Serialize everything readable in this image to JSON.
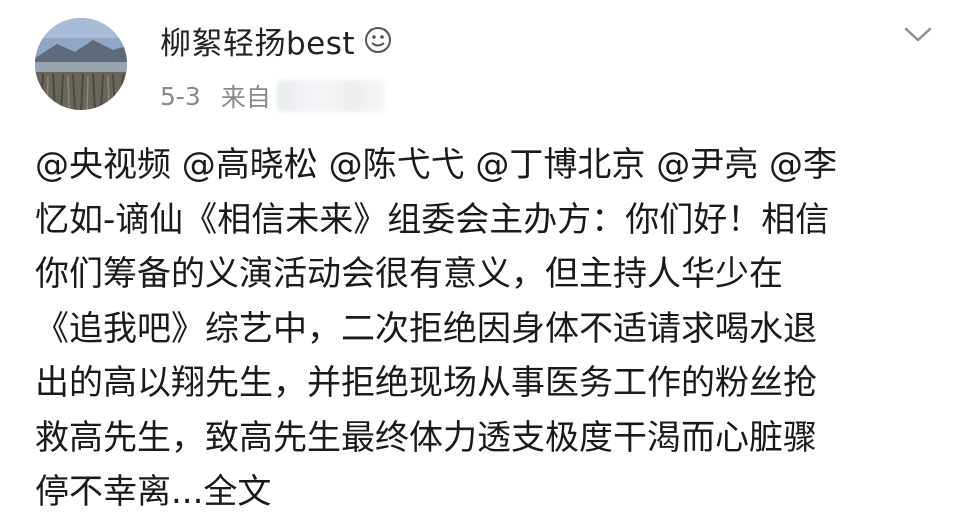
{
  "post": {
    "author": "柳絮轻扬best",
    "date": "5-3",
    "source_prefix": "来自",
    "body_lines": [
      "@央视频 @高晓松 @陈弋弋 @丁博北京 @尹亮 @李",
      "忆如-谪仙《相信未来》组委会主办方：你们好！相信",
      "你们筹备的义演活动会很有意义，但主持人华少在",
      "《追我吧》综艺中，二次拒绝因身体不适请求喝水退",
      "出的高以翔先生，并拒绝现场从事医务工作的粉丝抢",
      "救高先生，致高先生最终体力透支极度干渴而心脏骤",
      "停不幸离...全文"
    ]
  },
  "icons": {
    "badge": "level-badge-icon",
    "more": "chevron-down-icon"
  },
  "colors": {
    "text_primary": "#1a1a1a",
    "text_meta": "#8a8a8a",
    "background": "#ffffff"
  }
}
